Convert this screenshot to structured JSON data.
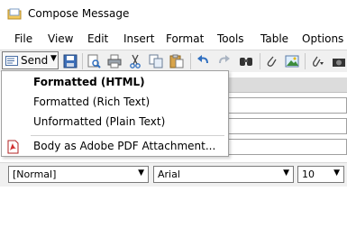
{
  "window": {
    "title": "Compose Message"
  },
  "menu": [
    "File",
    "View",
    "Edit",
    "Insert",
    "Format",
    "Tools",
    "Table",
    "Options"
  ],
  "toolbar": {
    "send_label": "Send"
  },
  "send_dropdown": {
    "items": [
      {
        "label": "Formatted (HTML)",
        "selected": true
      },
      {
        "label": "Formatted (Rich Text)",
        "selected": false
      },
      {
        "label": "Unformatted (Plain Text)",
        "selected": false
      },
      {
        "label": "Body as Adobe PDF Attachment...",
        "icon": "pdf-icon"
      }
    ]
  },
  "formatbar": {
    "style": "[Normal]",
    "font": "Arial",
    "size": "10"
  },
  "colors": {
    "toolbar_bg": "#f0f0f0",
    "accent_blue": "#2f6fc0"
  }
}
